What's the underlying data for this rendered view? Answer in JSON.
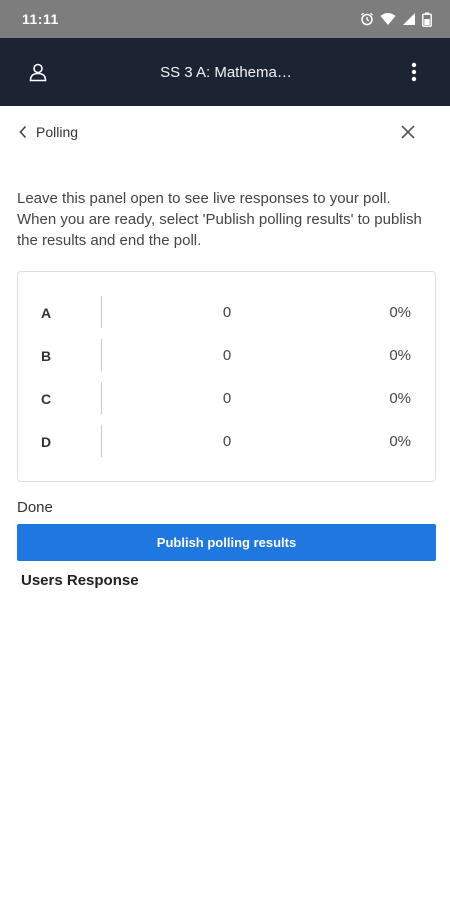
{
  "status_bar": {
    "time": "11:11",
    "icons": [
      "alarm-icon",
      "wifi-icon",
      "signal-icon",
      "battery-icon"
    ]
  },
  "app_bar": {
    "title": "SS 3 A: Mathema…",
    "left_icon": "user-icon",
    "right_icon": "more-vertical-icon"
  },
  "panel": {
    "back_label": "Polling",
    "close_icon": "close-icon"
  },
  "description": "Leave this panel open to see live responses to your poll. When you are ready, select 'Publish polling results' to publish the results and end the poll.",
  "results": [
    {
      "option": "A",
      "count": "0",
      "percent": "0%"
    },
    {
      "option": "B",
      "count": "0",
      "percent": "0%"
    },
    {
      "option": "C",
      "count": "0",
      "percent": "0%"
    },
    {
      "option": "D",
      "count": "0",
      "percent": "0%"
    }
  ],
  "done_label": "Done",
  "publish_button": "Publish polling results",
  "users_response_heading": "Users Response",
  "colors": {
    "app_bar": "#1c2433",
    "accent": "#1f77e0",
    "status_bar": "#7d7d7d"
  }
}
